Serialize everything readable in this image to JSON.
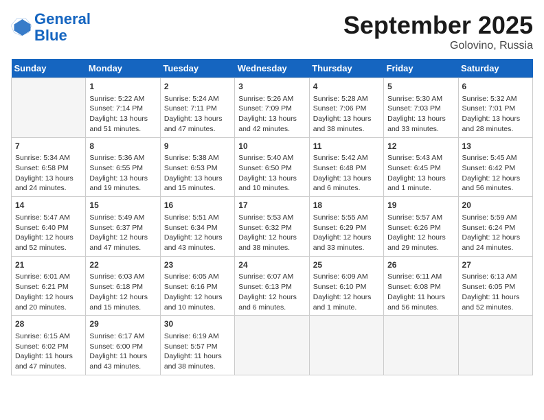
{
  "header": {
    "logo_line1": "General",
    "logo_line2": "Blue",
    "month": "September 2025",
    "location": "Golovino, Russia"
  },
  "weekdays": [
    "Sunday",
    "Monday",
    "Tuesday",
    "Wednesday",
    "Thursday",
    "Friday",
    "Saturday"
  ],
  "weeks": [
    [
      {
        "day": "",
        "info": ""
      },
      {
        "day": "1",
        "info": "Sunrise: 5:22 AM\nSunset: 7:14 PM\nDaylight: 13 hours\nand 51 minutes."
      },
      {
        "day": "2",
        "info": "Sunrise: 5:24 AM\nSunset: 7:11 PM\nDaylight: 13 hours\nand 47 minutes."
      },
      {
        "day": "3",
        "info": "Sunrise: 5:26 AM\nSunset: 7:09 PM\nDaylight: 13 hours\nand 42 minutes."
      },
      {
        "day": "4",
        "info": "Sunrise: 5:28 AM\nSunset: 7:06 PM\nDaylight: 13 hours\nand 38 minutes."
      },
      {
        "day": "5",
        "info": "Sunrise: 5:30 AM\nSunset: 7:03 PM\nDaylight: 13 hours\nand 33 minutes."
      },
      {
        "day": "6",
        "info": "Sunrise: 5:32 AM\nSunset: 7:01 PM\nDaylight: 13 hours\nand 28 minutes."
      }
    ],
    [
      {
        "day": "7",
        "info": "Sunrise: 5:34 AM\nSunset: 6:58 PM\nDaylight: 13 hours\nand 24 minutes."
      },
      {
        "day": "8",
        "info": "Sunrise: 5:36 AM\nSunset: 6:55 PM\nDaylight: 13 hours\nand 19 minutes."
      },
      {
        "day": "9",
        "info": "Sunrise: 5:38 AM\nSunset: 6:53 PM\nDaylight: 13 hours\nand 15 minutes."
      },
      {
        "day": "10",
        "info": "Sunrise: 5:40 AM\nSunset: 6:50 PM\nDaylight: 13 hours\nand 10 minutes."
      },
      {
        "day": "11",
        "info": "Sunrise: 5:42 AM\nSunset: 6:48 PM\nDaylight: 13 hours\nand 6 minutes."
      },
      {
        "day": "12",
        "info": "Sunrise: 5:43 AM\nSunset: 6:45 PM\nDaylight: 13 hours\nand 1 minute."
      },
      {
        "day": "13",
        "info": "Sunrise: 5:45 AM\nSunset: 6:42 PM\nDaylight: 12 hours\nand 56 minutes."
      }
    ],
    [
      {
        "day": "14",
        "info": "Sunrise: 5:47 AM\nSunset: 6:40 PM\nDaylight: 12 hours\nand 52 minutes."
      },
      {
        "day": "15",
        "info": "Sunrise: 5:49 AM\nSunset: 6:37 PM\nDaylight: 12 hours\nand 47 minutes."
      },
      {
        "day": "16",
        "info": "Sunrise: 5:51 AM\nSunset: 6:34 PM\nDaylight: 12 hours\nand 43 minutes."
      },
      {
        "day": "17",
        "info": "Sunrise: 5:53 AM\nSunset: 6:32 PM\nDaylight: 12 hours\nand 38 minutes."
      },
      {
        "day": "18",
        "info": "Sunrise: 5:55 AM\nSunset: 6:29 PM\nDaylight: 12 hours\nand 33 minutes."
      },
      {
        "day": "19",
        "info": "Sunrise: 5:57 AM\nSunset: 6:26 PM\nDaylight: 12 hours\nand 29 minutes."
      },
      {
        "day": "20",
        "info": "Sunrise: 5:59 AM\nSunset: 6:24 PM\nDaylight: 12 hours\nand 24 minutes."
      }
    ],
    [
      {
        "day": "21",
        "info": "Sunrise: 6:01 AM\nSunset: 6:21 PM\nDaylight: 12 hours\nand 20 minutes."
      },
      {
        "day": "22",
        "info": "Sunrise: 6:03 AM\nSunset: 6:18 PM\nDaylight: 12 hours\nand 15 minutes."
      },
      {
        "day": "23",
        "info": "Sunrise: 6:05 AM\nSunset: 6:16 PM\nDaylight: 12 hours\nand 10 minutes."
      },
      {
        "day": "24",
        "info": "Sunrise: 6:07 AM\nSunset: 6:13 PM\nDaylight: 12 hours\nand 6 minutes."
      },
      {
        "day": "25",
        "info": "Sunrise: 6:09 AM\nSunset: 6:10 PM\nDaylight: 12 hours\nand 1 minute."
      },
      {
        "day": "26",
        "info": "Sunrise: 6:11 AM\nSunset: 6:08 PM\nDaylight: 11 hours\nand 56 minutes."
      },
      {
        "day": "27",
        "info": "Sunrise: 6:13 AM\nSunset: 6:05 PM\nDaylight: 11 hours\nand 52 minutes."
      }
    ],
    [
      {
        "day": "28",
        "info": "Sunrise: 6:15 AM\nSunset: 6:02 PM\nDaylight: 11 hours\nand 47 minutes."
      },
      {
        "day": "29",
        "info": "Sunrise: 6:17 AM\nSunset: 6:00 PM\nDaylight: 11 hours\nand 43 minutes."
      },
      {
        "day": "30",
        "info": "Sunrise: 6:19 AM\nSunset: 5:57 PM\nDaylight: 11 hours\nand 38 minutes."
      },
      {
        "day": "",
        "info": ""
      },
      {
        "day": "",
        "info": ""
      },
      {
        "day": "",
        "info": ""
      },
      {
        "day": "",
        "info": ""
      }
    ]
  ]
}
